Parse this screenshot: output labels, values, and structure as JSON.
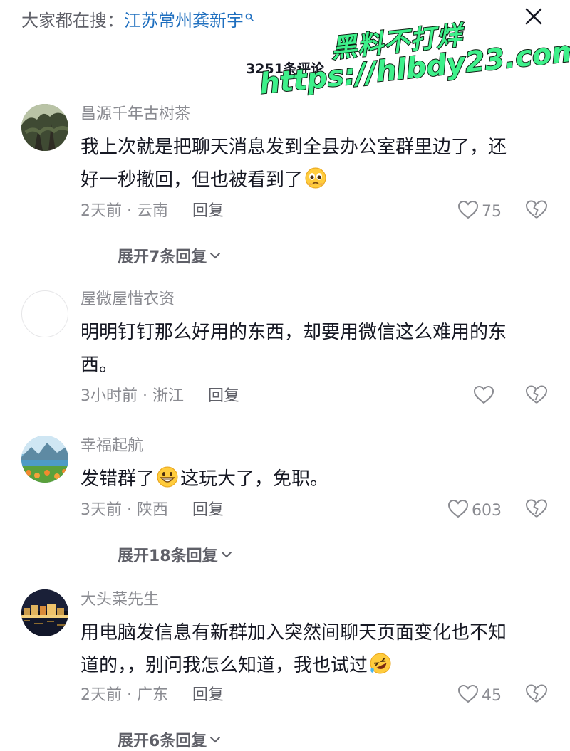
{
  "header": {
    "search_prefix": "大家都在搜：",
    "search_term": "江苏常州龚新宇",
    "comment_count": "3251条评论"
  },
  "watermark": {
    "line1": "黑料不打烊",
    "line2": "https://hlbdy23.com"
  },
  "comments": [
    {
      "username": "昌源千年古树茶",
      "text_lines": [
        "我上次就是把聊天消息发到全县办公室群里边了，还",
        "好一秒撤回，但也被看到了"
      ],
      "emoji": "pleading-face",
      "time_location": "2天前 · 云南",
      "reply_label": "回复",
      "likes": "75",
      "expand_label": "展开7条回复"
    },
    {
      "username": "屋微屋惜衣资",
      "text_lines": [
        "明明钉钉那么好用的东西，却要用微信这么难用的东",
        "西。"
      ],
      "time_location": "3小时前 · 浙江",
      "reply_label": "回复",
      "likes": ""
    },
    {
      "username": "幸福起航",
      "text_before_emoji": "发错群了",
      "emoji": "grinning-face",
      "text_after_emoji": "这玩大了，免职。",
      "time_location": "3天前 · 陕西",
      "reply_label": "回复",
      "likes": "603",
      "expand_label": "展开18条回复"
    },
    {
      "username": "大头菜先生",
      "text_lines": [
        "用电脑发信息有新群加入突然间聊天页面变化也不知",
        "道的，，别问我怎么知道，我也试过"
      ],
      "emoji": "rofl-face",
      "time_location": "2天前 · 广东",
      "reply_label": "回复",
      "likes": "45",
      "expand_label": "展开6条回复"
    }
  ],
  "colors": {
    "text_primary": "#161823",
    "text_secondary": "#8a8b91",
    "link": "#1f6fbf",
    "watermark": "#3ef08a"
  }
}
